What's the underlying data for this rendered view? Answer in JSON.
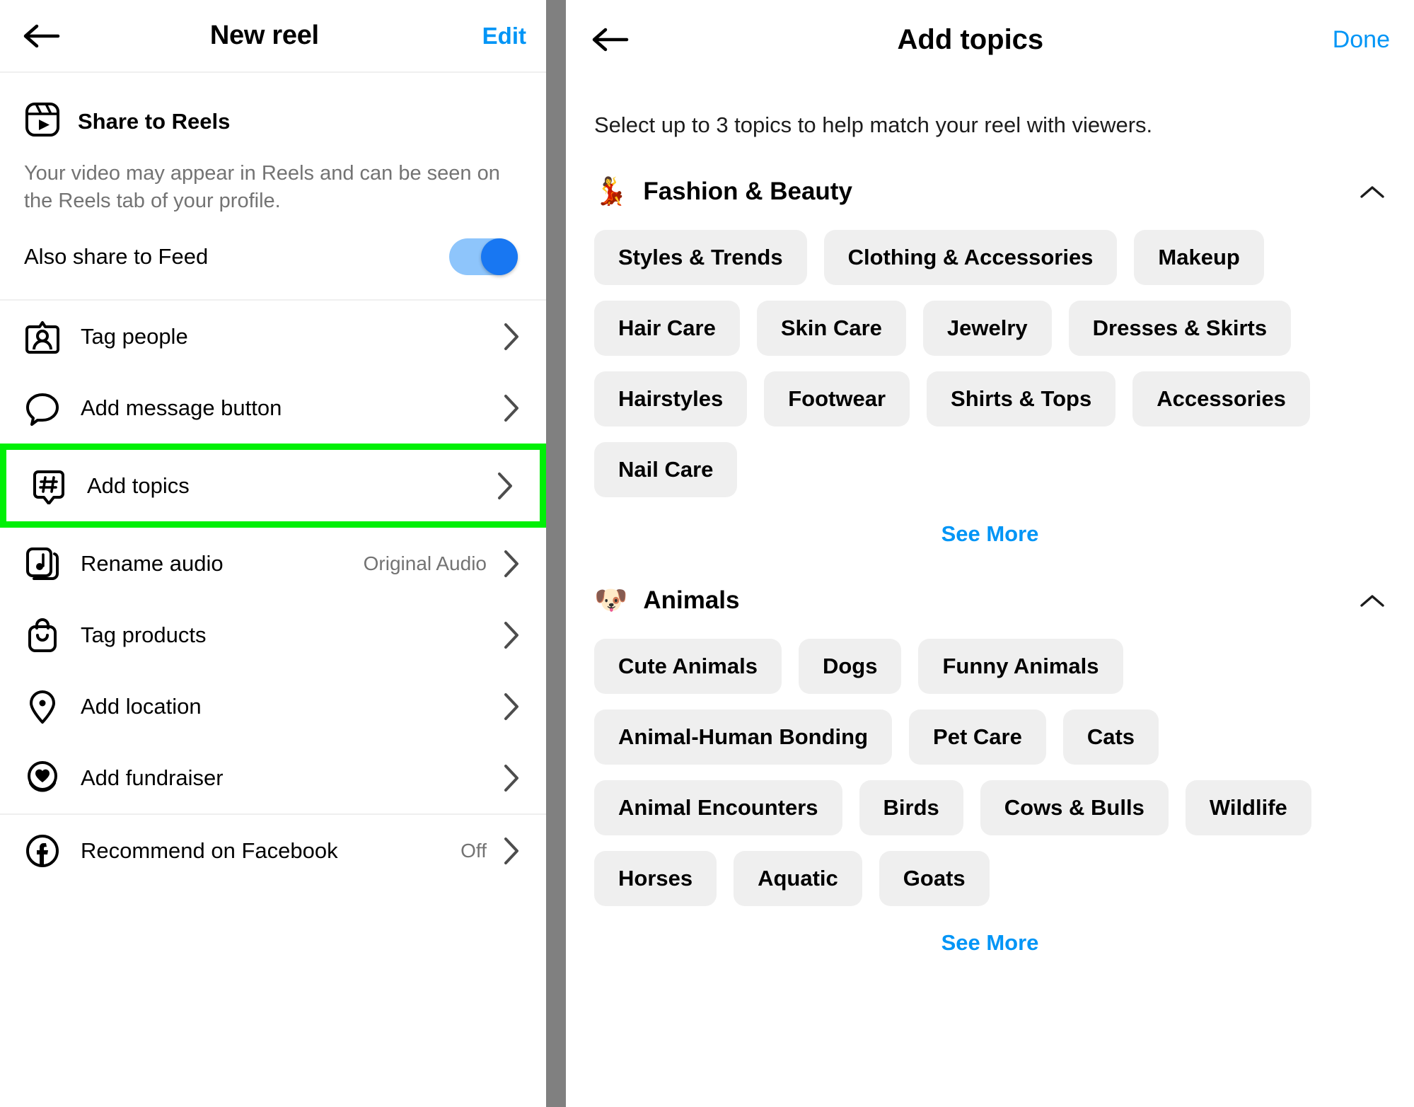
{
  "left": {
    "header": {
      "back_icon": "back-arrow-icon",
      "title": "New reel",
      "edit_label": "Edit"
    },
    "share": {
      "icon": "reels-icon",
      "title": "Share to Reels",
      "description": "Your video may appear in Reels and can be seen on the Reels tab of your profile.",
      "feed_label": "Also share to Feed",
      "feed_toggle_on": true
    },
    "menu_items": [
      {
        "icon": "tag-people-icon",
        "label": "Tag people",
        "value": "",
        "highlighted": false
      },
      {
        "icon": "message-bubble-icon",
        "label": "Add message button",
        "value": "",
        "highlighted": false
      },
      {
        "icon": "hashtag-bubble-icon",
        "label": "Add topics",
        "value": "",
        "highlighted": true
      },
      {
        "icon": "music-note-icon",
        "label": "Rename audio",
        "value": "Original Audio",
        "highlighted": false
      },
      {
        "icon": "shopping-bag-icon",
        "label": "Tag products",
        "value": "",
        "highlighted": false
      },
      {
        "icon": "location-pin-icon",
        "label": "Add location",
        "value": "",
        "highlighted": false
      },
      {
        "icon": "heart-circle-icon",
        "label": "Add fundraiser",
        "value": "",
        "highlighted": false
      },
      {
        "icon": "facebook-icon",
        "label": "Recommend on Facebook",
        "value": "Off",
        "highlighted": false
      }
    ],
    "highlight_color": "#00f006"
  },
  "right": {
    "header": {
      "back_icon": "back-arrow-icon",
      "title": "Add topics",
      "done_label": "Done"
    },
    "subtitle": "Select up to 3 topics to help match your reel with viewers.",
    "sections": [
      {
        "emoji": "💃",
        "emoji_name": "dancer-emoji",
        "title": "Fashion & Beauty",
        "collapse_icon": "chevron-up-icon",
        "chips": [
          "Styles & Trends",
          "Clothing & Accessories",
          "Makeup",
          "Hair Care",
          "Skin Care",
          "Jewelry",
          "Dresses & Skirts",
          "Hairstyles",
          "Footwear",
          "Shirts & Tops",
          "Accessories",
          "Nail Care"
        ],
        "see_more_label": "See More"
      },
      {
        "emoji": "🐶",
        "emoji_name": "dog-face-emoji",
        "title": "Animals",
        "collapse_icon": "chevron-up-icon",
        "chips": [
          "Cute Animals",
          "Dogs",
          "Funny Animals",
          "Animal-Human Bonding",
          "Pet Care",
          "Cats",
          "Animal Encounters",
          "Birds",
          "Cows & Bulls",
          "Wildlife",
          "Horses",
          "Aquatic",
          "Goats"
        ],
        "see_more_label": "See More"
      }
    ]
  },
  "colors": {
    "accent_blue": "#0095f6",
    "toggle_on": "#1877f2",
    "chip_bg": "#efefef",
    "muted_text": "#737373",
    "highlight_green": "#00f006",
    "divider_gray": "#808080"
  }
}
